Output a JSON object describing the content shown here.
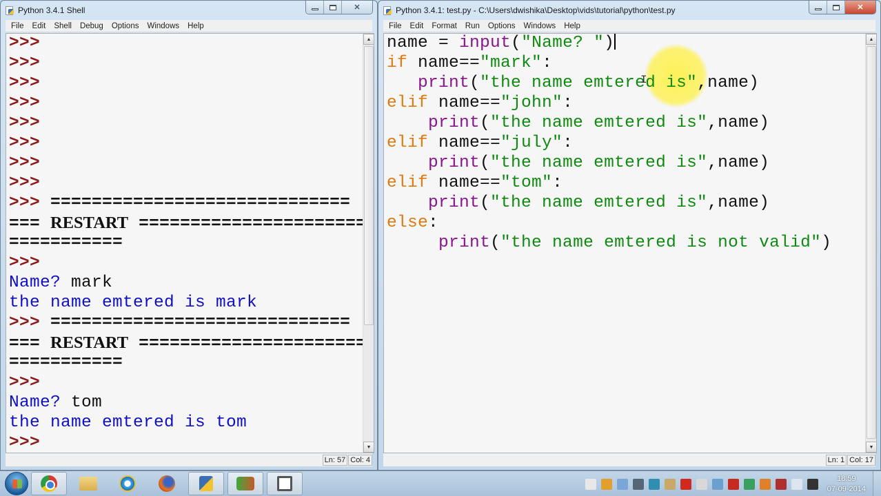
{
  "shell_window": {
    "title": "Python 3.4.1 Shell",
    "menu": [
      "File",
      "Edit",
      "Shell",
      "Debug",
      "Options",
      "Windows",
      "Help"
    ],
    "status": {
      "line": "Ln: 57",
      "col": "Col: 4"
    },
    "lines": [
      {
        "type": "prompt",
        "prompt": ">>>",
        "text": ""
      },
      {
        "type": "prompt",
        "prompt": ">>>",
        "text": ""
      },
      {
        "type": "prompt",
        "prompt": ">>>",
        "text": ""
      },
      {
        "type": "prompt",
        "prompt": ">>>",
        "text": ""
      },
      {
        "type": "prompt",
        "prompt": ">>>",
        "text": ""
      },
      {
        "type": "prompt",
        "prompt": ">>>",
        "text": ""
      },
      {
        "type": "prompt",
        "prompt": ">>>",
        "text": ""
      },
      {
        "type": "prompt",
        "prompt": ">>>",
        "text": ""
      },
      {
        "type": "prompt-eq",
        "prompt": ">>>",
        "text": " ============================="
      },
      {
        "type": "restart",
        "pre": "=== ",
        "word": "RESTART",
        "post": " ======================"
      },
      {
        "type": "eq",
        "text": "==========="
      },
      {
        "type": "prompt",
        "prompt": ">>>",
        "text": ""
      },
      {
        "type": "input",
        "label": "Name? ",
        "value": "mark"
      },
      {
        "type": "output",
        "text": "the name emtered is mark"
      },
      {
        "type": "prompt-eq",
        "prompt": ">>>",
        "text": " ============================="
      },
      {
        "type": "restart",
        "pre": "=== ",
        "word": "RESTART",
        "post": " ======================"
      },
      {
        "type": "eq",
        "text": "==========="
      },
      {
        "type": "prompt",
        "prompt": ">>>",
        "text": ""
      },
      {
        "type": "input",
        "label": "Name? ",
        "value": "tom"
      },
      {
        "type": "output",
        "text": "the name emtered is tom"
      },
      {
        "type": "prompt",
        "prompt": ">>>",
        "text": ""
      }
    ]
  },
  "editor_window": {
    "title": "Python 3.4.1: test.py - C:\\Users\\dwishika\\Desktop\\vids\\tutorial\\python\\test.py",
    "menu": [
      "File",
      "Edit",
      "Format",
      "Run",
      "Options",
      "Windows",
      "Help"
    ],
    "status": {
      "line": "Ln: 1",
      "col": "Col: 17"
    },
    "code_lines": [
      [
        {
          "t": "plain",
          "s": "name = "
        },
        {
          "t": "bi",
          "s": "input"
        },
        {
          "t": "plain",
          "s": "("
        },
        {
          "t": "str",
          "s": "\"Name? \""
        },
        {
          "t": "plain",
          "s": ")"
        }
      ],
      [
        {
          "t": "kw",
          "s": "if"
        },
        {
          "t": "plain",
          "s": " name=="
        },
        {
          "t": "str",
          "s": "\"mark\""
        },
        {
          "t": "plain",
          "s": ":"
        }
      ],
      [
        {
          "t": "plain",
          "s": "   "
        },
        {
          "t": "bi",
          "s": "print"
        },
        {
          "t": "plain",
          "s": "("
        },
        {
          "t": "str",
          "s": "\"the name emtered is\""
        },
        {
          "t": "plain",
          "s": ",name)"
        }
      ],
      [
        {
          "t": "kw",
          "s": "elif"
        },
        {
          "t": "plain",
          "s": " name=="
        },
        {
          "t": "str",
          "s": "\"john\""
        },
        {
          "t": "plain",
          "s": ":"
        }
      ],
      [
        {
          "t": "plain",
          "s": "    "
        },
        {
          "t": "bi",
          "s": "print"
        },
        {
          "t": "plain",
          "s": "("
        },
        {
          "t": "str",
          "s": "\"the name emtered is\""
        },
        {
          "t": "plain",
          "s": ",name)"
        }
      ],
      [
        {
          "t": "kw",
          "s": "elif"
        },
        {
          "t": "plain",
          "s": " name=="
        },
        {
          "t": "str",
          "s": "\"july\""
        },
        {
          "t": "plain",
          "s": ":"
        }
      ],
      [
        {
          "t": "plain",
          "s": "    "
        },
        {
          "t": "bi",
          "s": "print"
        },
        {
          "t": "plain",
          "s": "("
        },
        {
          "t": "str",
          "s": "\"the name emtered is\""
        },
        {
          "t": "plain",
          "s": ",name)"
        }
      ],
      [
        {
          "t": "kw",
          "s": "elif"
        },
        {
          "t": "plain",
          "s": " name=="
        },
        {
          "t": "str",
          "s": "\"tom\""
        },
        {
          "t": "plain",
          "s": ":"
        }
      ],
      [
        {
          "t": "plain",
          "s": "    "
        },
        {
          "t": "bi",
          "s": "print"
        },
        {
          "t": "plain",
          "s": "("
        },
        {
          "t": "str",
          "s": "\"the name emtered is\""
        },
        {
          "t": "plain",
          "s": ",name)"
        }
      ],
      [
        {
          "t": "kw",
          "s": "else"
        },
        {
          "t": "plain",
          "s": ":"
        }
      ],
      [
        {
          "t": "plain",
          "s": "     "
        },
        {
          "t": "bi",
          "s": "print"
        },
        {
          "t": "plain",
          "s": "("
        },
        {
          "t": "str",
          "s": "\"the name emtered is not valid\""
        },
        {
          "t": "plain",
          "s": ")"
        }
      ]
    ]
  },
  "taskbar": {
    "start_label": "Start",
    "apps": [
      {
        "name": "chrome",
        "icon": "chrome-icon",
        "active": true
      },
      {
        "name": "file-explorer",
        "icon": "folder-icon",
        "active": false
      },
      {
        "name": "internet-explorer",
        "icon": "ie-icon",
        "active": false
      },
      {
        "name": "firefox",
        "icon": "firefox-icon",
        "active": false
      },
      {
        "name": "python-idle",
        "icon": "python-icon",
        "active": true
      },
      {
        "name": "media-app",
        "icon": "media-icon",
        "active": true
      },
      {
        "name": "app",
        "icon": "app-icon",
        "active": true
      }
    ],
    "tray_icons": [
      "folder-tray-icon",
      "security-tray-icon",
      "chat-tray-icon",
      "signal-tray-icon",
      "network-tray-icon",
      "word-tray-icon",
      "flash-tray-icon",
      "action-center-flag-icon",
      "display-tray-icon",
      "acrobat-tray-icon",
      "update-tray-icon",
      "vlc-tray-icon",
      "power-tray-icon",
      "volume-icon",
      "webcam-tray-icon"
    ],
    "clock": {
      "time": "18:59",
      "date": "07-09-2014"
    }
  },
  "colors": {
    "prompt": "#8b1a1a",
    "output": "#1010c8",
    "keyword": "#e07a10",
    "builtin": "#8a158f",
    "string": "#108a10",
    "close_button": "#c8452f"
  }
}
